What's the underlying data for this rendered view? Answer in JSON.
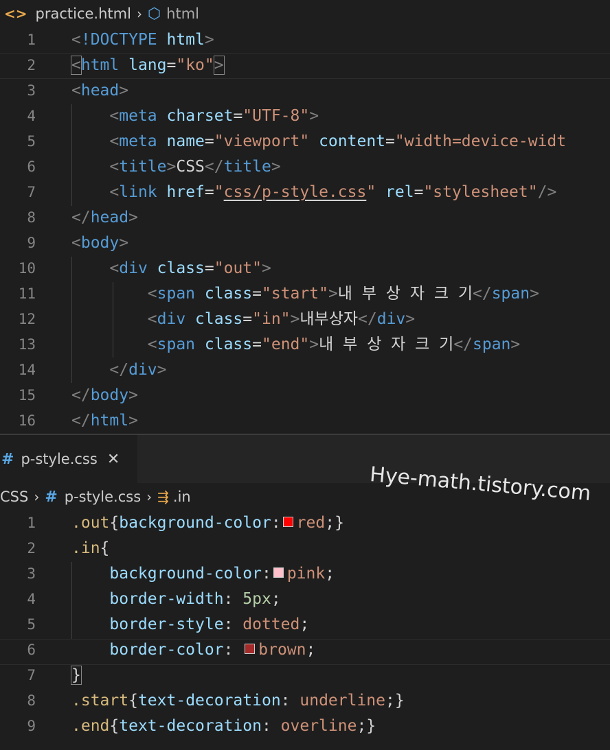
{
  "html_editor": {
    "breadcrumb": {
      "file": "practice.html",
      "symbol": "html"
    },
    "lines": [
      {
        "n": "1",
        "tokens": [
          [
            "punc",
            "<"
          ],
          [
            "tag",
            "!DOCTYPE "
          ],
          [
            "attr",
            "html"
          ],
          [
            "punc",
            ">"
          ]
        ]
      },
      {
        "n": "2",
        "tokens": [
          [
            "punc",
            "<"
          ],
          [
            "tag",
            "html "
          ],
          [
            "attr",
            "lang"
          ],
          [
            "text",
            "="
          ],
          [
            "str",
            "\"ko\""
          ],
          [
            "punc",
            ">"
          ]
        ]
      },
      {
        "n": "3",
        "tokens": [
          [
            "punc",
            "<"
          ],
          [
            "tag",
            "head"
          ],
          [
            "punc",
            ">"
          ]
        ]
      },
      {
        "n": "4",
        "tokens": [
          [
            "text",
            "    "
          ],
          [
            "punc",
            "<"
          ],
          [
            "tag",
            "meta "
          ],
          [
            "attr",
            "charset"
          ],
          [
            "text",
            "="
          ],
          [
            "str",
            "\"UTF-8\""
          ],
          [
            "punc",
            ">"
          ]
        ]
      },
      {
        "n": "5",
        "tokens": [
          [
            "text",
            "    "
          ],
          [
            "punc",
            "<"
          ],
          [
            "tag",
            "meta "
          ],
          [
            "attr",
            "name"
          ],
          [
            "text",
            "="
          ],
          [
            "str",
            "\"viewport\" "
          ],
          [
            "attr",
            "content"
          ],
          [
            "text",
            "="
          ],
          [
            "str",
            "\"width=device-widt"
          ]
        ]
      },
      {
        "n": "6",
        "tokens": [
          [
            "text",
            "    "
          ],
          [
            "punc",
            "<"
          ],
          [
            "tag",
            "title"
          ],
          [
            "punc",
            ">"
          ],
          [
            "text",
            "CSS"
          ],
          [
            "punc",
            "</"
          ],
          [
            "tag",
            "title"
          ],
          [
            "punc",
            ">"
          ]
        ]
      },
      {
        "n": "7",
        "tokens": [
          [
            "text",
            "    "
          ],
          [
            "punc",
            "<"
          ],
          [
            "tag",
            "link "
          ],
          [
            "attr",
            "href"
          ],
          [
            "text",
            "="
          ],
          [
            "str",
            "\""
          ],
          [
            "strsq",
            "css/p-style.css"
          ],
          [
            "str",
            "\" "
          ],
          [
            "attr",
            "rel"
          ],
          [
            "text",
            "="
          ],
          [
            "str",
            "\"stylesheet\""
          ],
          [
            "punc",
            "/>"
          ]
        ]
      },
      {
        "n": "8",
        "tokens": [
          [
            "punc",
            "</"
          ],
          [
            "tag",
            "head"
          ],
          [
            "punc",
            ">"
          ]
        ]
      },
      {
        "n": "9",
        "tokens": [
          [
            "punc",
            "<"
          ],
          [
            "tag",
            "body"
          ],
          [
            "punc",
            ">"
          ]
        ]
      },
      {
        "n": "10",
        "tokens": [
          [
            "text",
            "    "
          ],
          [
            "punc",
            "<"
          ],
          [
            "tag",
            "div "
          ],
          [
            "attr",
            "class"
          ],
          [
            "text",
            "="
          ],
          [
            "str",
            "\"out\""
          ],
          [
            "punc",
            ">"
          ]
        ]
      },
      {
        "n": "11",
        "tokens": [
          [
            "text",
            "        "
          ],
          [
            "punc",
            "<"
          ],
          [
            "tag",
            "span "
          ],
          [
            "attr",
            "class"
          ],
          [
            "text",
            "="
          ],
          [
            "str",
            "\"start\""
          ],
          [
            "punc",
            ">"
          ],
          [
            "text",
            "내 부 상 자 크 기"
          ],
          [
            "punc",
            "</"
          ],
          [
            "tag",
            "span"
          ],
          [
            "punc",
            ">"
          ]
        ]
      },
      {
        "n": "12",
        "tokens": [
          [
            "text",
            "        "
          ],
          [
            "punc",
            "<"
          ],
          [
            "tag",
            "div "
          ],
          [
            "attr",
            "class"
          ],
          [
            "text",
            "="
          ],
          [
            "str",
            "\"in\""
          ],
          [
            "punc",
            ">"
          ],
          [
            "text",
            "내부상자"
          ],
          [
            "punc",
            "</"
          ],
          [
            "tag",
            "div"
          ],
          [
            "punc",
            ">"
          ]
        ]
      },
      {
        "n": "13",
        "tokens": [
          [
            "text",
            "        "
          ],
          [
            "punc",
            "<"
          ],
          [
            "tag",
            "span "
          ],
          [
            "attr",
            "class"
          ],
          [
            "text",
            "="
          ],
          [
            "str",
            "\"end\""
          ],
          [
            "punc",
            ">"
          ],
          [
            "text",
            "내 부 상 자 크 기"
          ],
          [
            "punc",
            "</"
          ],
          [
            "tag",
            "span"
          ],
          [
            "punc",
            ">"
          ]
        ]
      },
      {
        "n": "14",
        "tokens": [
          [
            "text",
            "    "
          ],
          [
            "punc",
            "</"
          ],
          [
            "tag",
            "div"
          ],
          [
            "punc",
            ">"
          ]
        ]
      },
      {
        "n": "15",
        "tokens": [
          [
            "punc",
            "</"
          ],
          [
            "tag",
            "body"
          ],
          [
            "punc",
            ">"
          ]
        ]
      },
      {
        "n": "16",
        "tokens": [
          [
            "punc",
            "</"
          ],
          [
            "tag",
            "html"
          ],
          [
            "punc",
            ">"
          ]
        ]
      }
    ]
  },
  "css_editor": {
    "tab": {
      "label": "p-style.css",
      "close_glyph": "✕"
    },
    "watermark": "Hye-math.tistory.com",
    "breadcrumb": {
      "folder": "CSS",
      "file": "p-style.css",
      "symbol": ".in"
    },
    "lines": [
      {
        "n": "1",
        "tokens": [
          [
            "sel",
            ".out"
          ],
          [
            "text",
            "{"
          ],
          [
            "prop",
            "background-color"
          ],
          [
            "text",
            ":"
          ],
          [
            "swatch",
            "#ff0000"
          ],
          [
            "str",
            "red"
          ],
          [
            "text",
            ";}"
          ]
        ]
      },
      {
        "n": "2",
        "tokens": [
          [
            "sel",
            ".in"
          ],
          [
            "text",
            "{"
          ]
        ]
      },
      {
        "n": "3",
        "tokens": [
          [
            "text",
            "    "
          ],
          [
            "prop",
            "background-color"
          ],
          [
            "text",
            ":"
          ],
          [
            "swatch",
            "#ffc0cb"
          ],
          [
            "str",
            "pink"
          ],
          [
            "text",
            ";"
          ]
        ]
      },
      {
        "n": "4",
        "tokens": [
          [
            "text",
            "    "
          ],
          [
            "prop",
            "border-width"
          ],
          [
            "text",
            ": "
          ],
          [
            "num",
            "5px"
          ],
          [
            "text",
            ";"
          ]
        ]
      },
      {
        "n": "5",
        "tokens": [
          [
            "text",
            "    "
          ],
          [
            "prop",
            "border-style"
          ],
          [
            "text",
            ": "
          ],
          [
            "str",
            "dotted"
          ],
          [
            "text",
            ";"
          ]
        ]
      },
      {
        "n": "6",
        "tokens": [
          [
            "text",
            "    "
          ],
          [
            "prop",
            "border-color"
          ],
          [
            "text",
            ": "
          ],
          [
            "swatch",
            "#a52a2a"
          ],
          [
            "str",
            "brown"
          ],
          [
            "text",
            ";"
          ]
        ]
      },
      {
        "n": "7",
        "tokens": [
          [
            "text",
            "}"
          ]
        ]
      },
      {
        "n": "8",
        "tokens": [
          [
            "sel",
            ".start"
          ],
          [
            "text",
            "{"
          ],
          [
            "prop",
            "text-decoration"
          ],
          [
            "text",
            ": "
          ],
          [
            "str",
            "underline"
          ],
          [
            "text",
            ";}"
          ]
        ]
      },
      {
        "n": "9",
        "tokens": [
          [
            "sel",
            ".end"
          ],
          [
            "text",
            "{"
          ],
          [
            "prop",
            "text-decoration"
          ],
          [
            "text",
            ": "
          ],
          [
            "str",
            "overline"
          ],
          [
            "text",
            ";}"
          ]
        ]
      }
    ]
  }
}
